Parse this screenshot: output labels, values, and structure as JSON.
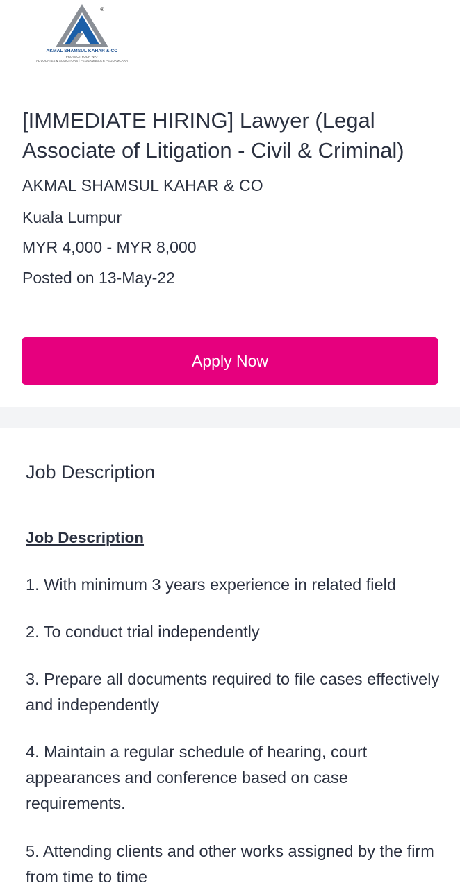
{
  "company_logo": {
    "name": "AKMAL SHAMSUL KAHAR & CO",
    "tagline": "PROTECT YOUR WAY",
    "subtitle": "ADVOCATES & SOLICITORS | PEGUAMBELA & PEGUAMCARA",
    "registered_mark": "®",
    "colors": {
      "primary": "#1b5fa8",
      "secondary": "#8a8f96"
    }
  },
  "job": {
    "title": "[IMMEDIATE HIRING] Lawyer (Legal Associate of Litigation - Civil & Criminal)",
    "company": "AKMAL SHAMSUL KAHAR & CO",
    "location": "Kuala Lumpur",
    "salary": "MYR 4,000 - MYR 8,000",
    "posted": "Posted on 13-May-22"
  },
  "apply_button": {
    "label": "Apply Now",
    "color": "#e6007e"
  },
  "description_section": {
    "title": "Job Description",
    "heading": "Job Description",
    "items": [
      "1. With minimum 3 years experience in related field",
      "2. To conduct trial independently",
      "3. Prepare all documents required to file cases effectively and independently",
      "4. Maintain a regular schedule of hearing, court appearances and conference based on case requirements.",
      "5. Attending clients and other works assigned by the firm from time to time"
    ]
  }
}
